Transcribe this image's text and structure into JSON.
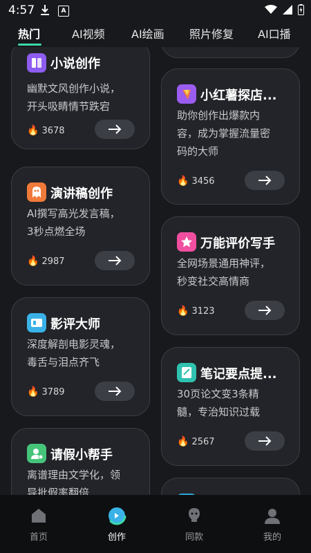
{
  "status_bar": {
    "time": "4:57"
  },
  "tabs": [
    {
      "label": "热门"
    },
    {
      "label": "AI视频"
    },
    {
      "label": "AI绘画"
    },
    {
      "label": "照片修复"
    },
    {
      "label": "AI口播"
    }
  ],
  "cards_left": [
    {
      "title": "小说创作",
      "desc": [
        "幽默文风创作小说，",
        "开头吸睛情节跌宕"
      ],
      "heat": "3678",
      "icon": "book-icon",
      "color": "#8e5cf0"
    },
    {
      "title": "演讲稿创作",
      "desc": [
        "AI撰写高光发言稿，",
        "3秒点燃全场"
      ],
      "heat": "2987",
      "icon": "ghost-icon",
      "color": "#f07a3a"
    },
    {
      "title": "影评大师",
      "desc": [
        "深度解剖电影灵魂，",
        "毒舌与泪点齐飞"
      ],
      "heat": "3789",
      "icon": "film-icon",
      "color": "#3ab2e8"
    },
    {
      "title": "请假小帮手",
      "desc": [
        "离谱理由文学化，领",
        "导批假率翻倍"
      ],
      "heat": "",
      "icon": "person-icon",
      "color": "#45c47a"
    }
  ],
  "cards_right": [
    {
      "title": "小红薯探店...",
      "desc": [
        "助你创作出爆款内",
        "容，成为掌握流量密",
        "码的大师"
      ],
      "heat": "3456",
      "icon": "shop-icon",
      "color": "#9b5cf0"
    },
    {
      "title": "万能评价写手",
      "desc": [
        "全网场景通用神评，",
        "秒变社交高情商"
      ],
      "heat": "3123",
      "icon": "star-icon",
      "color": "#f04fa0"
    },
    {
      "title": "笔记要点提...",
      "desc": [
        "30页论文变3条精",
        "髓，专治知识过载"
      ],
      "heat": "2567",
      "icon": "note-icon",
      "color": "#2fc2b0"
    }
  ],
  "bottom_nav": [
    {
      "label": "首页",
      "icon": "home-icon"
    },
    {
      "label": "创作",
      "icon": "create-icon"
    },
    {
      "label": "同款",
      "icon": "bulb-icon"
    },
    {
      "label": "我的",
      "icon": "profile-icon"
    }
  ],
  "colors": {
    "accent": "#3ed9a8",
    "background": "#17191c",
    "card": "#222429"
  }
}
